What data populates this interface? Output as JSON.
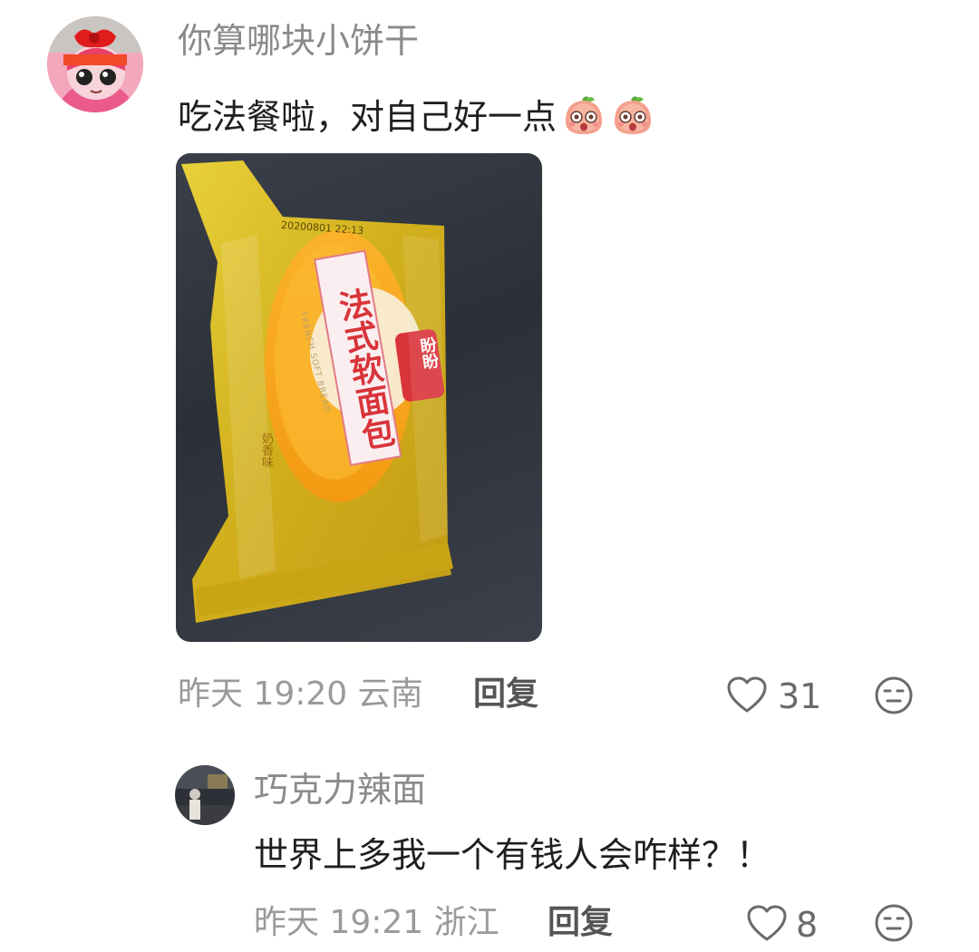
{
  "comment": {
    "username": "你算哪块小饼干",
    "text": "吃法餐啦，对自己好一点",
    "emojis": [
      "peach-face-emoji",
      "peach-face-emoji"
    ],
    "time": "昨天 19:20",
    "location": "云南",
    "reply_label": "回复",
    "likes": "31",
    "image": {
      "package_title": "法式软面包",
      "brand": "盼盼",
      "print_code": "20200801 22:13",
      "small_text": "FRENCH SOFT BREAD",
      "side_label": "奶香味"
    }
  },
  "reply": {
    "username": "巧克力辣面",
    "text": "世界上多我一个有钱人会咋样？！",
    "time": "昨天 19:21",
    "location": "浙江",
    "reply_label": "回复",
    "likes": "8"
  },
  "colors": {
    "username": "#8a8a8a",
    "text": "#1f1f1f",
    "meta": "#9a9a9a",
    "package_yellow": "#e6c21a",
    "bread_orange": "#f6a21a",
    "label_red": "#d8343a"
  }
}
